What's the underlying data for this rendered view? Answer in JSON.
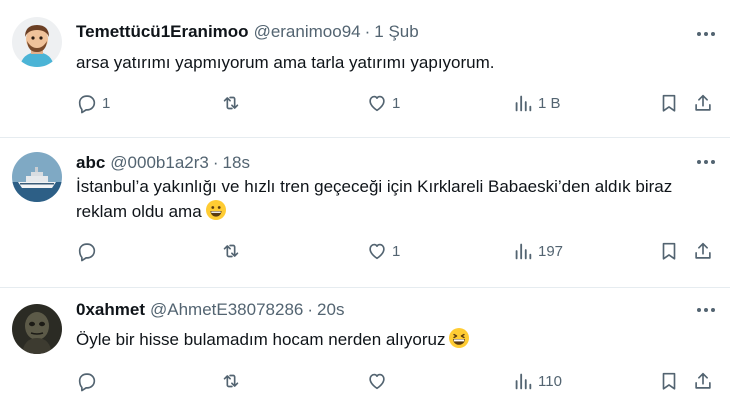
{
  "tweets": [
    {
      "display_name": "Temettücü1Eranimoo",
      "handle": "@eranimoo94",
      "time": "1 Şub",
      "text": "arsa yatırımı yapmıyorum ama tarla yatırımı yapıyorum.",
      "emoji": "",
      "reply_count": "1",
      "retweet_count": "",
      "like_count": "1",
      "view_count": "1 B"
    },
    {
      "display_name": "abc",
      "handle": "@000b1a2r3",
      "time": "18s",
      "text": "İstanbul’a yakınlığı ve hızlı tren geçeceği için Kırklareli Babaeski’den aldık biraz reklam oldu ama",
      "emoji": "grinning-face",
      "reply_count": "",
      "retweet_count": "",
      "like_count": "1",
      "view_count": "197"
    },
    {
      "display_name": "0xahmet",
      "handle": "@AhmetE38078286",
      "time": "20s",
      "text": "Öyle bir hisse bulamadım hocam nerden alıyoruz",
      "emoji": "grinning-squinting-face",
      "reply_count": "",
      "retweet_count": "",
      "like_count": "",
      "view_count": "110"
    }
  ],
  "separator": "·",
  "colors": {
    "text": "#0f1419",
    "muted": "#536471",
    "divider": "#e6ecf0"
  },
  "icons": [
    "reply-icon",
    "retweet-icon",
    "like-icon",
    "views-icon",
    "bookmark-icon",
    "share-icon",
    "more-icon"
  ]
}
